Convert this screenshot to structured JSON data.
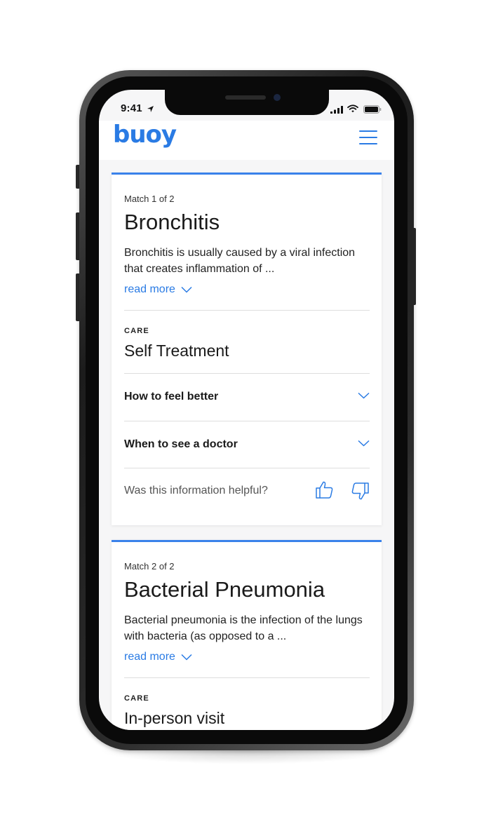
{
  "status_bar": {
    "time": "9:41"
  },
  "header": {
    "logo_text": "buoy",
    "accent_color": "#2a7be4"
  },
  "matches": [
    {
      "match_label": "Match 1 of 2",
      "title": "Bronchitis",
      "description": "Bronchitis is usually caused by a viral infection that creates inflammation of ...",
      "read_more": "read more",
      "care_label": "CARE",
      "care_value": "Self Treatment",
      "accordions": [
        {
          "label": "How to feel better"
        },
        {
          "label": "When to see a doctor"
        }
      ],
      "feedback_question": "Was this information helpful?"
    },
    {
      "match_label": "Match 2 of 2",
      "title": "Bacterial Pneumonia",
      "description": "Bacterial pneumonia is the infection of the lungs with bacteria (as opposed to a ...",
      "read_more": "read more",
      "care_label": "CARE",
      "care_value": "In-person visit"
    }
  ],
  "icons": {
    "location": "location-arrow-icon",
    "signal": "cell-signal-icon",
    "wifi": "wifi-icon",
    "battery": "battery-icon",
    "menu": "hamburger-menu-icon",
    "chevron": "chevron-down-icon",
    "thumbs_up": "thumbs-up-icon",
    "thumbs_down": "thumbs-down-icon"
  }
}
